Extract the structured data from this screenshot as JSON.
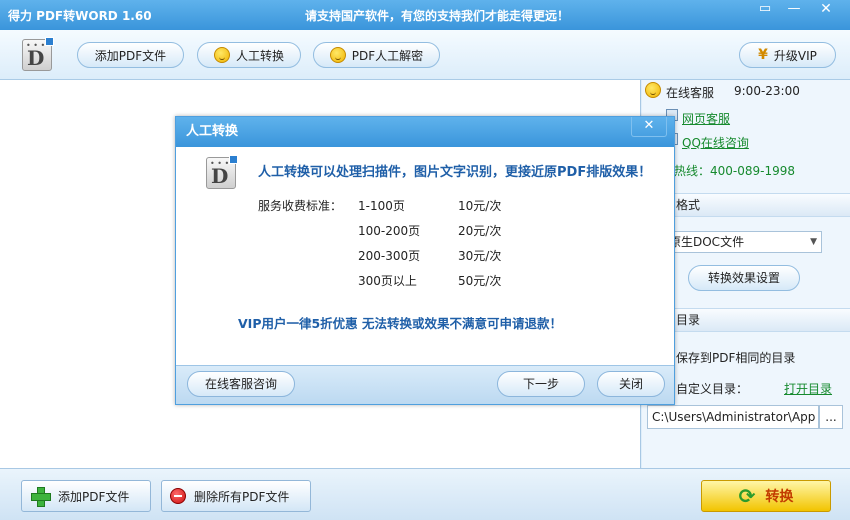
{
  "titlebar": {
    "app_title": "得力 PDF转WORD 1.60",
    "slogan": "请支持国产软件，有您的支持我们才能走得更远！",
    "min_label": "—",
    "max_label": "▭",
    "close_label": "✕"
  },
  "toolbar": {
    "add_pdf": "添加PDF文件",
    "manual_convert": "人工转换",
    "pdf_decrypt": "PDF人工解密",
    "upgrade_vip": "升级VIP"
  },
  "side": {
    "online_service": "在线客服",
    "service_hours": "9:00-23:00",
    "web_service": "网页客服",
    "qq_service": "QQ在线咨询",
    "hotline": "客服热线：400-089-1998",
    "output_format_head": "输出格式",
    "format_value": "原生DOC文件",
    "convert_settings": "转换效果设置",
    "output_dir_head": "输出目录",
    "save_same_dir": "保存到PDF相同的目录",
    "custom_dir": "自定义目录：",
    "open_dir": "打开目录",
    "path_value": "C:\\Users\\Administrator\\App",
    "browse": "..."
  },
  "bottom": {
    "add_pdf": "添加PDF文件",
    "delete_all": "删除所有PDF文件",
    "convert": "转换"
  },
  "dialog": {
    "title": "人工转换",
    "close_label": "✕",
    "headline": "人工转换可以处理扫描件，图片文字识别，更接近原PDF排版效果！",
    "fee_label": "服务收费标准：",
    "fees": [
      {
        "range": "1-100页",
        "price": "10元/次"
      },
      {
        "range": "100-200页",
        "price": "20元/次"
      },
      {
        "range": "200-300页",
        "price": "30元/次"
      },
      {
        "range": "300页以上",
        "price": "50元/次"
      }
    ],
    "vip_note": "VIP用户一律5折优惠  无法转换或效果不满意可申请退款！",
    "consult": "在线客服咨询",
    "next": "下一步",
    "close": "关闭"
  },
  "colors": {
    "accent_blue": "#3a95db",
    "link_green": "#168a2e",
    "headline_blue": "#1f5fa8",
    "convert_yellow": "#f2c400"
  }
}
